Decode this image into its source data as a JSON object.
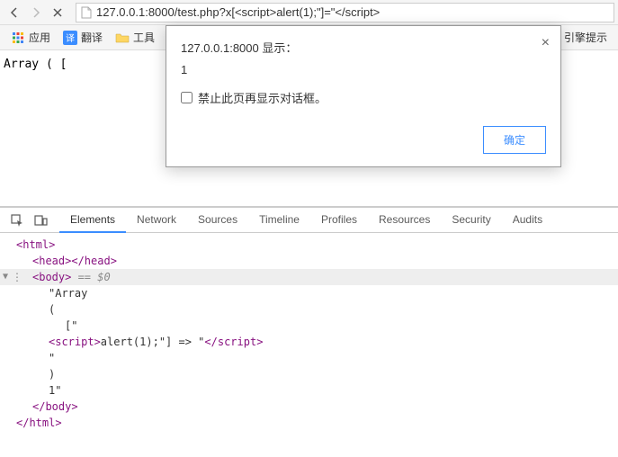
{
  "toolbar": {
    "url": "127.0.0.1:8000/test.php?x[<script>alert(1);\"]=\"</script>"
  },
  "bookmarks": {
    "apps": "应用",
    "translate": "翻译",
    "tools": "工具",
    "truncated": "引擎提示"
  },
  "page": {
    "text": "Array ( ["
  },
  "dialog": {
    "title": "127.0.0.1:8000 显示：",
    "message": "1",
    "checkbox_label": "禁止此页再显示对话框。",
    "ok_button": "确定"
  },
  "devtools": {
    "tabs": {
      "elements": "Elements",
      "network": "Network",
      "sources": "Sources",
      "timeline": "Timeline",
      "profiles": "Profiles",
      "resources": "Resources",
      "security": "Security",
      "audits": "Audits"
    },
    "elements": {
      "html_open": "<html>",
      "head": "<head></head>",
      "body_open": "<body>",
      "eq0": " == $0",
      "array_line": "\"Array",
      "paren_open": "(",
      "bracket_quote": "[\"",
      "script_open": "<script>",
      "script_text": "alert(1);\"] => \"",
      "script_close": "</script>",
      "quote_line": "\"",
      "paren_close": ")",
      "one_quote": "1\"",
      "body_close": "</body>",
      "html_close": "</html>"
    }
  }
}
